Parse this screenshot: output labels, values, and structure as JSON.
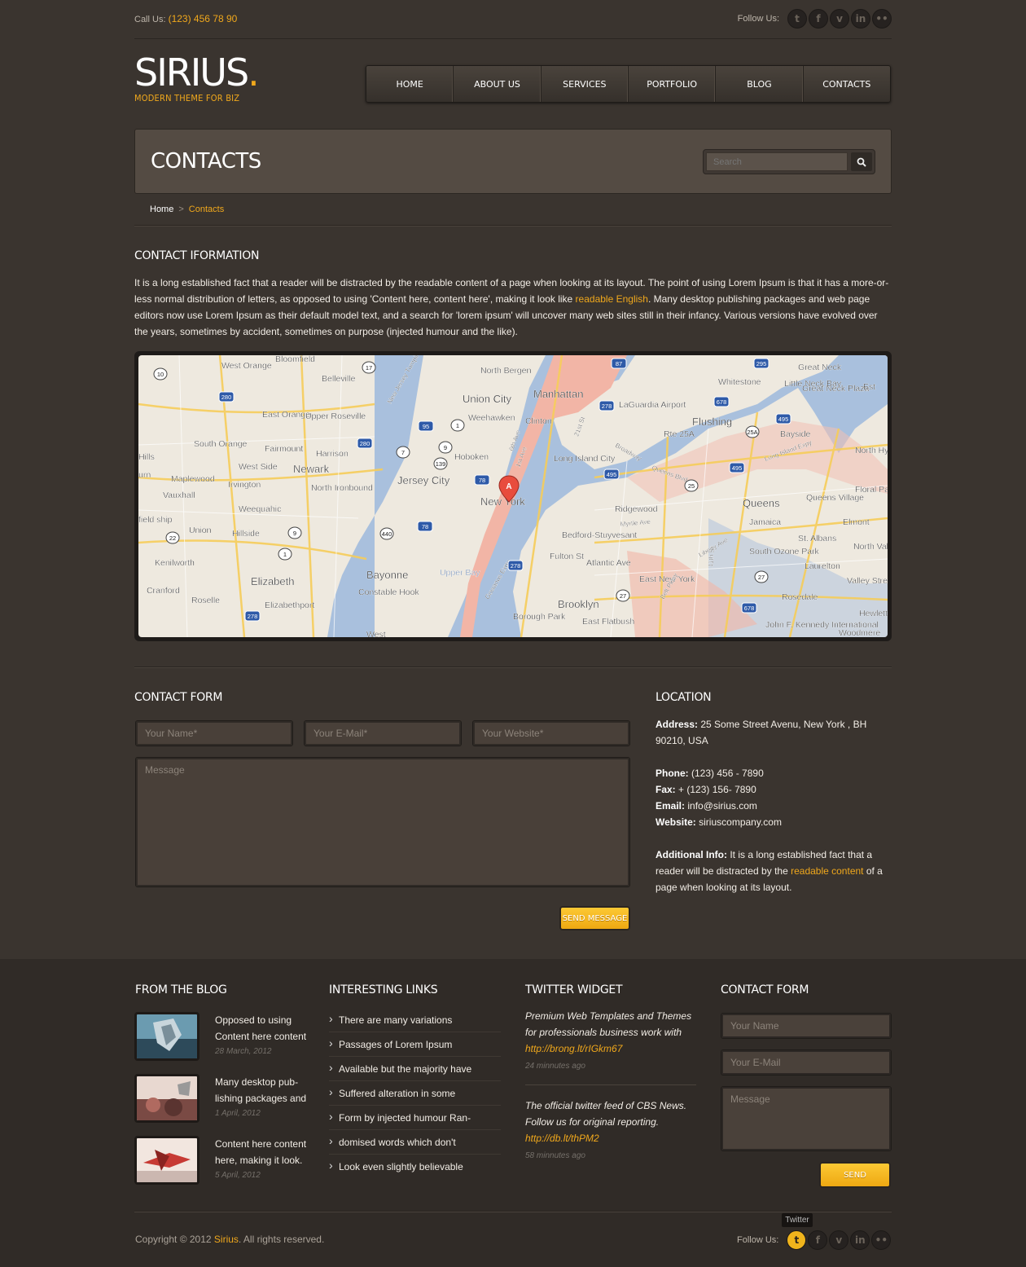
{
  "topbar": {
    "call_label": "Call Us:",
    "phone": "(123) 456 78 90",
    "follow_label": "Follow Us:",
    "social": [
      {
        "name": "twitter-icon",
        "glyph": "t"
      },
      {
        "name": "facebook-icon",
        "glyph": "f"
      },
      {
        "name": "vimeo-icon",
        "glyph": "v"
      },
      {
        "name": "linkedin-icon",
        "glyph": "in"
      },
      {
        "name": "flickr-icon",
        "glyph": "••"
      }
    ]
  },
  "logo": {
    "name": "SIRIUS",
    "dot": ".",
    "tagline": "MODERN THEME FOR BIZ"
  },
  "nav": {
    "items": [
      "HOME",
      "ABOUT US",
      "SERVICES",
      "PORTFOLIO",
      "BLOG",
      "CONTACTS"
    ]
  },
  "page": {
    "title": "CONTACTS",
    "search_placeholder": "Search"
  },
  "breadcrumb": {
    "home": "Home",
    "sep": ">",
    "current": "Contacts"
  },
  "info": {
    "title": "CONTACT IFORMATION",
    "text_before": "It is a long established fact that a reader will be distracted by the readable content of a page when looking at its layout. The point of using Lorem Ipsum is that it has a more-or-less normal distribution of letters, as opposed to using 'Content here, content here', making it look like ",
    "link": "readable English",
    "text_after": ". Many desktop publishing packages and web page editors now use Lorem Ipsum as their default model text, and a search for 'lorem ipsum' will uncover many web sites still in their infancy. Various versions have evolved over the years, sometimes by accident, sometimes on purpose (injected humour and the like)."
  },
  "map": {
    "marker": "A",
    "labels": [
      "Bloomfield",
      "West Orange",
      "Belleville",
      "North Bergen",
      "Manhattan",
      "Union City",
      "East Orange",
      "Upper Roseville",
      "Weehawken",
      "Clinton",
      "LaGuardia Airport",
      "Flushing",
      "Whitestone",
      "Great Neck",
      "Great Neck Plaza",
      "Little Neck Bay",
      "Bayside",
      "South Orange",
      "Fairmount",
      "Harrison",
      "Hoboken",
      "Newark",
      "Jersey City",
      "New York",
      "Long Island City",
      "West Side",
      "Maplewood",
      "Irvington",
      "Vauxhall",
      "North Ironbound",
      "Weequahic",
      "Ridgewood",
      "Queens",
      "Queens Village",
      "Floral Park",
      "North Hyde Park",
      "Union",
      "Hillside",
      "Bedford-Stuyvesant",
      "Jamaica",
      "St. Albans",
      "Elmont",
      "North Valley Stream",
      "Kenilworth",
      "South Ozone Park",
      "Laurelton",
      "Valley Stream",
      "Elizabeth",
      "Bayonne",
      "East New York",
      "Cranford",
      "Roselle",
      "Elizabethport",
      "Constable Hook",
      "Upper Bay",
      "Brooklyn",
      "Borough Park",
      "East Flatbush",
      "Rosedale",
      "John F. Kennedy International",
      "Woodmere",
      "Hewlett",
      "West",
      "Hills",
      "urn",
      "field ship",
      "Long Island Expy",
      "Queens Blvd",
      "Broadway",
      "21st St",
      "6th Ave",
      "1st Ave",
      "Rte 25A",
      "Myrtle Ave",
      "Fulton St",
      "Atlantic Ave",
      "Liberty Ave",
      "Belt Pkwy",
      "Gowanus Expy",
      "New Jersey Turnpike",
      "11th St",
      "Est"
    ],
    "shields": [
      "10",
      "17",
      "87",
      "295",
      "280",
      "95",
      "1",
      "278",
      "678",
      "495",
      "280",
      "7",
      "9",
      "139",
      "78",
      "25A",
      "25",
      "495",
      "495",
      "78",
      "22",
      "9",
      "1",
      "440",
      "78",
      "278",
      "27",
      "678",
      "27",
      "278"
    ]
  },
  "contact_form": {
    "title": "CONTACT FORM",
    "name_placeholder": "Your Name*",
    "email_placeholder": "Your E-Mail*",
    "website_placeholder": "Your Website*",
    "message_placeholder": "Message",
    "send_label": "SEND MESSAGE"
  },
  "location": {
    "title": "LOCATION",
    "address_label": "Address:",
    "address": "25 Some Street Avenu, New York , BH 90210, USA",
    "phone_label": "Phone:",
    "phone": "(123) 456 - 7890",
    "fax_label": "Fax:",
    "fax": "+ (123) 156- 7890",
    "email_label": "Email:",
    "email": "info@sirius.com",
    "website_label": "Website:",
    "website": "siriuscompany.com",
    "info_label": "Additional Info:",
    "info_before": "It is a long established fact that a reader will be distracted by the ",
    "info_link": "readable content",
    "info_after": " of a page when looking at its layout."
  },
  "footer": {
    "blog": {
      "title": "FROM THE BLOG",
      "items": [
        {
          "title": "Opposed to using Content here content",
          "date": "28 March, 2012"
        },
        {
          "title": "Many desktop pub-lishing packages and",
          "date": "1 April, 2012"
        },
        {
          "title": "Content here content here, making it look.",
          "date": "5 April, 2012"
        }
      ]
    },
    "links": {
      "title": "INTERESTING LINKS",
      "items": [
        "There are many variations",
        "Passages of Lorem Ipsum",
        "Available but the majority have",
        "Suffered alteration in some",
        "Form by injected humour Ran-",
        "domised words which don't",
        "Look even slightly believable"
      ]
    },
    "twitter": {
      "title": "TWITTER WIDGET",
      "tweets": [
        {
          "text": "Premium Web Templates and Themes for professionals business work with ",
          "link": "http://brong.lt/rIGkm67",
          "ago": "24 minnutes ago"
        },
        {
          "text": "The official twitter feed of CBS News. Follow us for original reporting. ",
          "link": "http://db.lt/thPM2",
          "ago": "58 minnutes ago"
        }
      ]
    },
    "form": {
      "title": "CONTACT FORM",
      "name_placeholder": "Your Name",
      "email_placeholder": "Your E-Mail",
      "message_placeholder": "Message",
      "send_label": "SEND"
    },
    "copyright_before": "Copyright © 2012 ",
    "copyright_brand": "Sirius",
    "copyright_after": ". All rights reserved.",
    "follow_label": "Follow Us:",
    "tooltip": "Twitter"
  },
  "colors": {
    "accent": "#f0a81c",
    "background": "#3a342f",
    "footer": "#302b27"
  }
}
